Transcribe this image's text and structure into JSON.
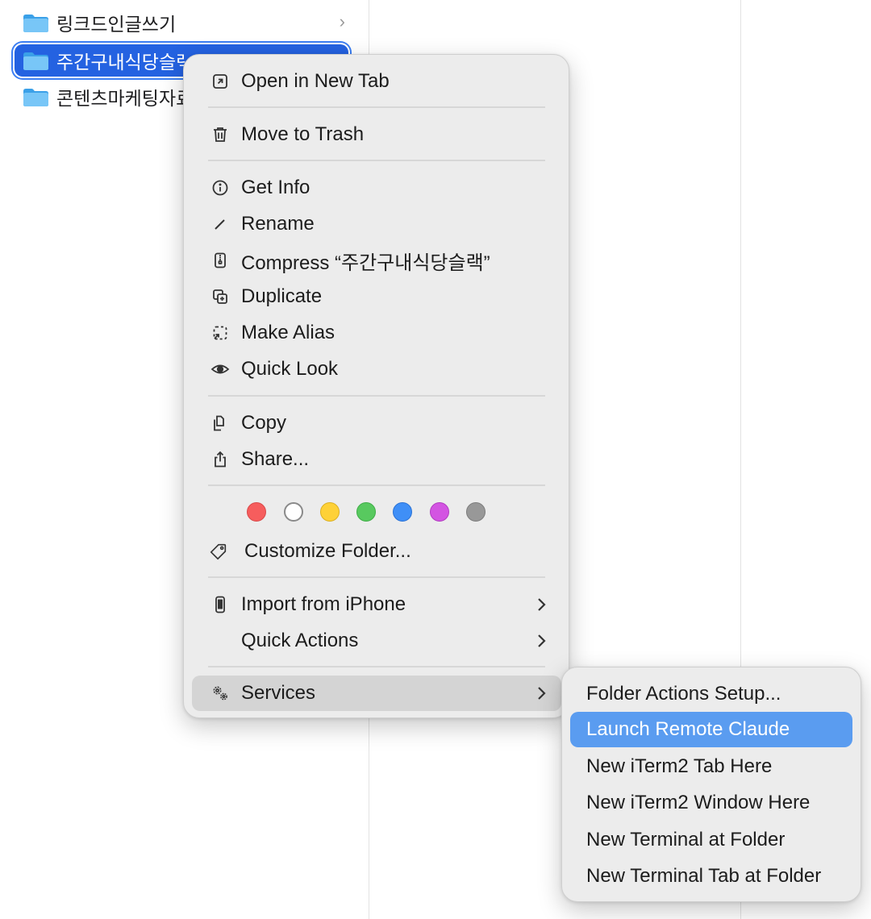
{
  "files": [
    {
      "name": "링크드인글쓰기",
      "selected": false
    },
    {
      "name": "주간구내식당슬랙",
      "selected": true
    },
    {
      "name": "콘텐츠마케팅자료",
      "selected": false
    }
  ],
  "context_menu": {
    "open_new_tab": "Open in New Tab",
    "move_to_trash": "Move to Trash",
    "get_info": "Get Info",
    "rename": "Rename",
    "compress": "Compress “주간구내식당슬랙”",
    "duplicate": "Duplicate",
    "make_alias": "Make Alias",
    "quick_look": "Quick Look",
    "copy": "Copy",
    "share": "Share...",
    "tag_colors": [
      "#f65d5d",
      "#ffffff",
      "#fed137",
      "#58c95f",
      "#3f8ff7",
      "#d354e2",
      "#989898"
    ],
    "customize_folder": "Customize Folder...",
    "import_iphone": "Import from iPhone",
    "quick_actions": "Quick Actions",
    "services": "Services"
  },
  "services_submenu": {
    "items": [
      "Folder Actions Setup...",
      "Launch Remote Claude",
      "New iTerm2 Tab Here",
      "New iTerm2 Window Here",
      "New Terminal at Folder",
      "New Terminal Tab at Folder"
    ],
    "active_index": 1
  },
  "colors": {
    "selection": "#2462e1",
    "submenu_highlight": "#5a9cf0",
    "menu_bg": "#ececec",
    "hover_bg": "#d4d4d4"
  }
}
